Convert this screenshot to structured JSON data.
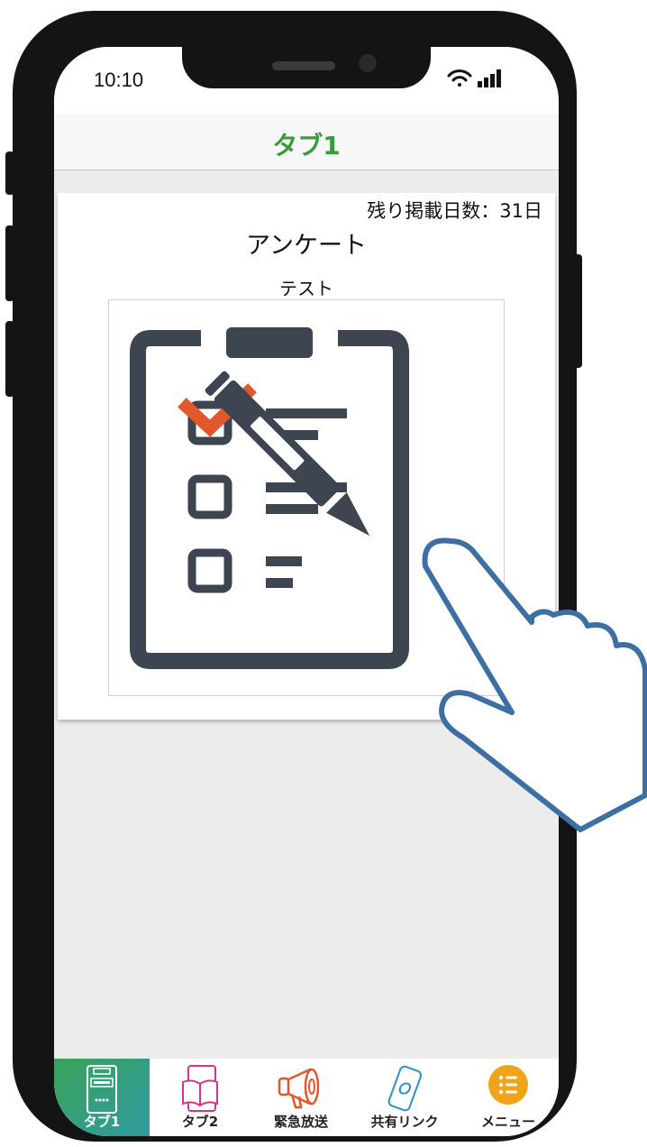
{
  "status_bar": {
    "time": "10:10",
    "icons": [
      "wifi-icon",
      "signal-icon"
    ]
  },
  "header": {
    "title": "タブ1",
    "title_color": "#3a9a3e"
  },
  "card": {
    "remaining_days": "残り掲載日数：31日",
    "title": "アンケート",
    "subtitle": "テスト",
    "image_icon": "clipboard-checklist-pencil-icon",
    "image_accent_color": "#e2572b",
    "image_main_color": "#3d4550"
  },
  "tab_bar": {
    "tabs": [
      {
        "label": "タブ1",
        "icon": "bulletin-board-icon",
        "active": true
      },
      {
        "label": "タブ2",
        "icon": "book-tablet-icon",
        "active": false
      },
      {
        "label": "緊急放送",
        "icon": "megaphone-icon",
        "active": false
      },
      {
        "label": "共有リンク",
        "icon": "phone-link-icon",
        "active": false
      },
      {
        "label": "メニュー",
        "icon": "menu-list-icon",
        "active": false
      }
    ],
    "active_gradient": [
      "#3aa35a",
      "#2f9aa0"
    ]
  },
  "overlay": {
    "icon": "pointing-hand-icon",
    "outline_color": "#3d6fa3"
  }
}
